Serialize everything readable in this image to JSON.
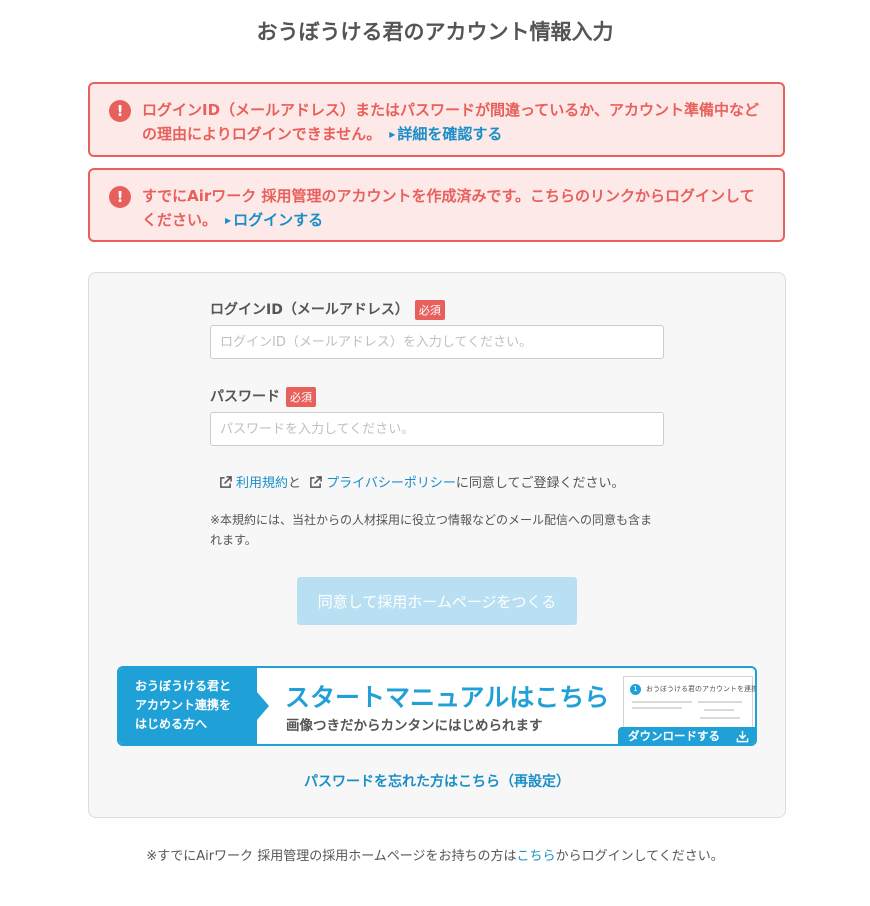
{
  "page": {
    "title": "おうぼうける君のアカウント情報入力"
  },
  "alerts": [
    {
      "icon": "exclamation-icon",
      "message": "ログインID（メールアドレス）またはパスワードが間違っているか、アカウント準備中などの理由によりログインできません。",
      "link": "詳細を確認する"
    },
    {
      "icon": "exclamation-icon",
      "message": "すでにAirワーク 採用管理のアカウントを作成済みです。こちらのリンクからログインしてください。",
      "link": "ログインする"
    }
  ],
  "form": {
    "login_label": "ログインID（メールアドレス）",
    "login_placeholder": "ログインID（メールアドレス）を入力してください。",
    "login_value": "",
    "password_label": "パスワード",
    "password_placeholder": "パスワードを入力してください。",
    "password_value": "",
    "required_badge": "必須",
    "terms_link": "利用規約",
    "terms_and": "と",
    "privacy_link": "プライバシーポリシー",
    "terms_suffix": "に同意してご登録ください。",
    "note": "※本規約には、当社からの人材採用に役立つ情報などのメール配信への同意も含まれます。",
    "submit": "同意して採用ホームページをつくる"
  },
  "banner": {
    "left_lines": [
      "おうぼうける君と",
      "アカウント連携を",
      "はじめる方へ"
    ],
    "title": "スタートマニュアルはこちら",
    "subtitle": "画像つきだからカンタンにはじめられます",
    "thumb_number": "1",
    "thumb_title": "おうぼうける君のアカウントを連携する",
    "download": "ダウンロードする"
  },
  "forgot_link": "パスワードを忘れた方はこちら（再設定）",
  "footer": {
    "prefix": "※すでにAirワーク 採用管理の採用ホームページをお持ちの方は",
    "link": "こちら",
    "suffix": "からログインしてください。"
  },
  "colors": {
    "accent": "#1fa0d6",
    "link": "#1a8fc7",
    "error": "#e8605c",
    "error_bg": "#fdeae8"
  }
}
